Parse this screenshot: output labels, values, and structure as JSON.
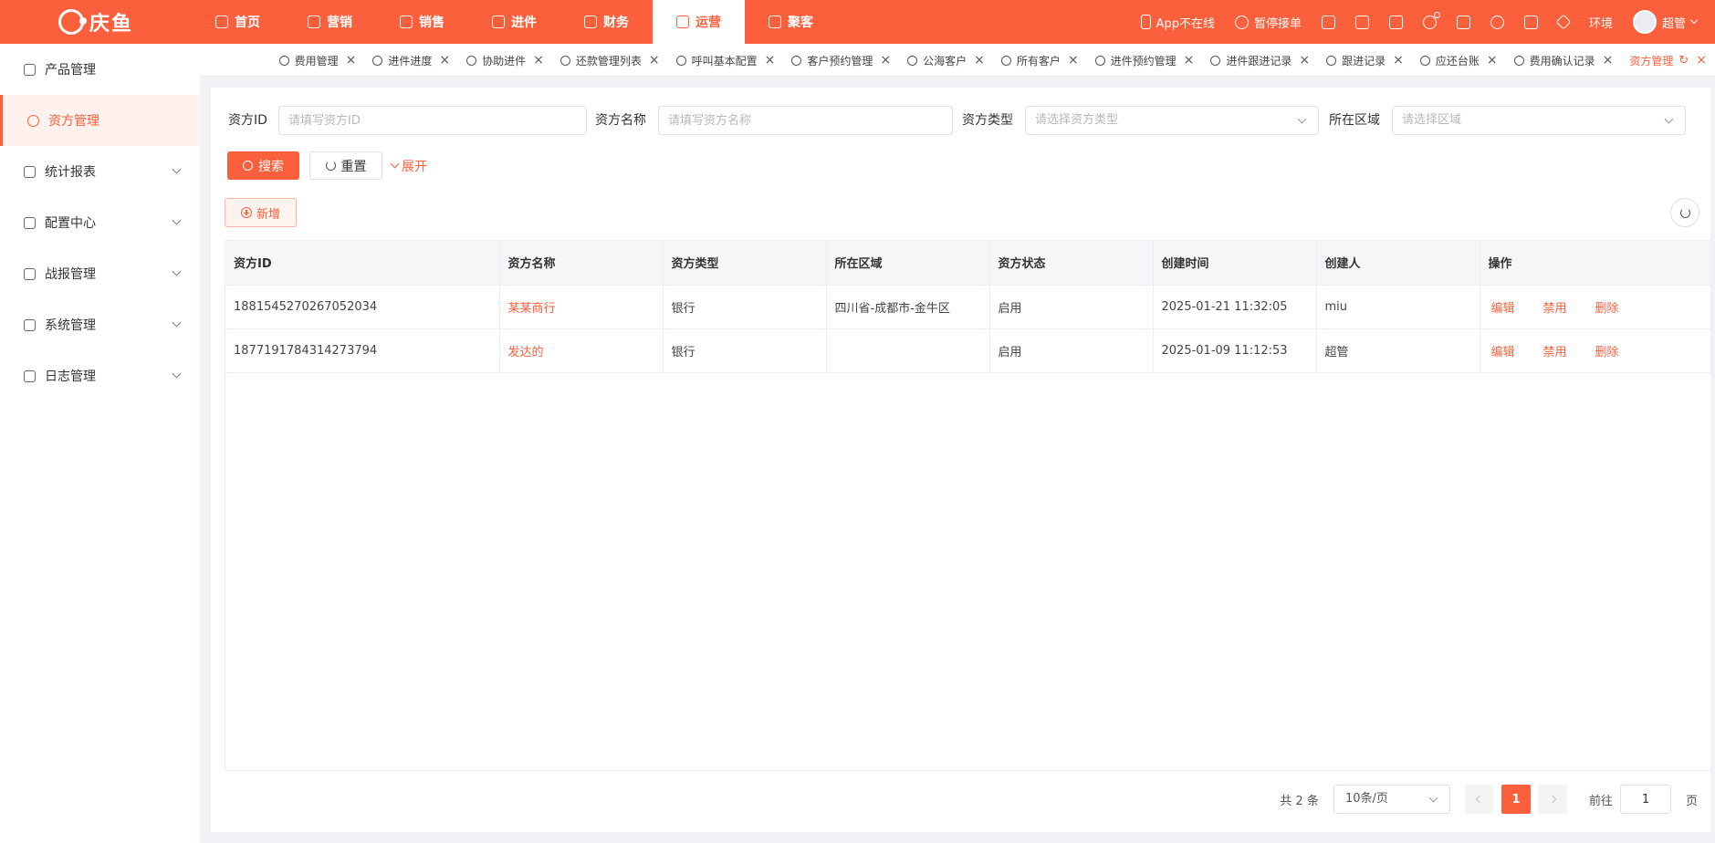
{
  "brand": {
    "name": "庆鱼"
  },
  "topnav": [
    {
      "label": "首页",
      "icon": "home-icon",
      "active": false
    },
    {
      "label": "营销",
      "icon": "marketing-icon",
      "active": false
    },
    {
      "label": "销售",
      "icon": "sales-icon",
      "active": false
    },
    {
      "label": "进件",
      "icon": "application-icon",
      "active": false
    },
    {
      "label": "财务",
      "icon": "finance-icon",
      "active": false
    },
    {
      "label": "运营",
      "icon": "operations-icon",
      "active": true
    },
    {
      "label": "聚客",
      "icon": "customers-icon",
      "active": false
    }
  ],
  "topright": {
    "app_status": "App不在线",
    "pause_orders": "暂停接单",
    "env": "环境",
    "user": "超管"
  },
  "sidebar": [
    {
      "label": "产品管理",
      "icon": "layers-icon",
      "active": false,
      "expandable": false
    },
    {
      "label": "资方管理",
      "icon": "investor-icon",
      "active": true,
      "expandable": false
    },
    {
      "label": "统计报表",
      "icon": "chart-icon",
      "active": false,
      "expandable": true
    },
    {
      "label": "配置中心",
      "icon": "gear-icon",
      "active": false,
      "expandable": true
    },
    {
      "label": "战报管理",
      "icon": "report-icon",
      "active": false,
      "expandable": true
    },
    {
      "label": "系统管理",
      "icon": "settings-icon",
      "active": false,
      "expandable": true
    },
    {
      "label": "日志管理",
      "icon": "log-icon",
      "active": false,
      "expandable": true
    }
  ],
  "tabs": [
    {
      "label": "费用管理",
      "active": false
    },
    {
      "label": "进件进度",
      "active": false
    },
    {
      "label": "协助进件",
      "active": false
    },
    {
      "label": "还款管理列表",
      "active": false
    },
    {
      "label": "呼叫基本配置",
      "active": false
    },
    {
      "label": "客户预约管理",
      "active": false
    },
    {
      "label": "公海客户",
      "active": false
    },
    {
      "label": "所有客户",
      "active": false
    },
    {
      "label": "进件预约管理",
      "active": false
    },
    {
      "label": "进件跟进记录",
      "active": false
    },
    {
      "label": "跟进记录",
      "active": false
    },
    {
      "label": "应还台账",
      "active": false
    },
    {
      "label": "费用确认记录",
      "active": false
    },
    {
      "label": "资方管理",
      "active": true
    }
  ],
  "filters": {
    "investor_id": {
      "label": "资方ID",
      "placeholder": "请填写资方ID"
    },
    "investor_name": {
      "label": "资方名称",
      "placeholder": "请填写资方名称"
    },
    "investor_type": {
      "label": "资方类型",
      "placeholder": "请选择资方类型"
    },
    "region": {
      "label": "所在区域",
      "placeholder": "请选择区域"
    }
  },
  "actions": {
    "search": "搜索",
    "reset": "重置",
    "expand": "展开",
    "add": "新增"
  },
  "table": {
    "columns": [
      "资方ID",
      "资方名称",
      "资方类型",
      "所在区域",
      "资方状态",
      "创建时间",
      "创建人",
      "操作"
    ],
    "rows": [
      {
        "id": "1881545270267052034",
        "name": "某某商行",
        "type": "银行",
        "region": "四川省-成都市-金牛区",
        "status": "启用",
        "created": "2025-01-21 11:32:05",
        "creator": "miu"
      },
      {
        "id": "1877191784314273794",
        "name": "发达的",
        "type": "银行",
        "region": "",
        "status": "启用",
        "created": "2025-01-09 11:12:53",
        "creator": "超管"
      }
    ],
    "row_actions": [
      "编辑",
      "禁用",
      "删除"
    ]
  },
  "pagination": {
    "total": "共 2 条",
    "page_size": "10条/页",
    "current_page": "1",
    "goto_label": "前往",
    "goto_value": "1",
    "page_suffix": "页"
  },
  "colors": {
    "accent": "#fc5f3c",
    "accent_light": "#fff1ed"
  }
}
